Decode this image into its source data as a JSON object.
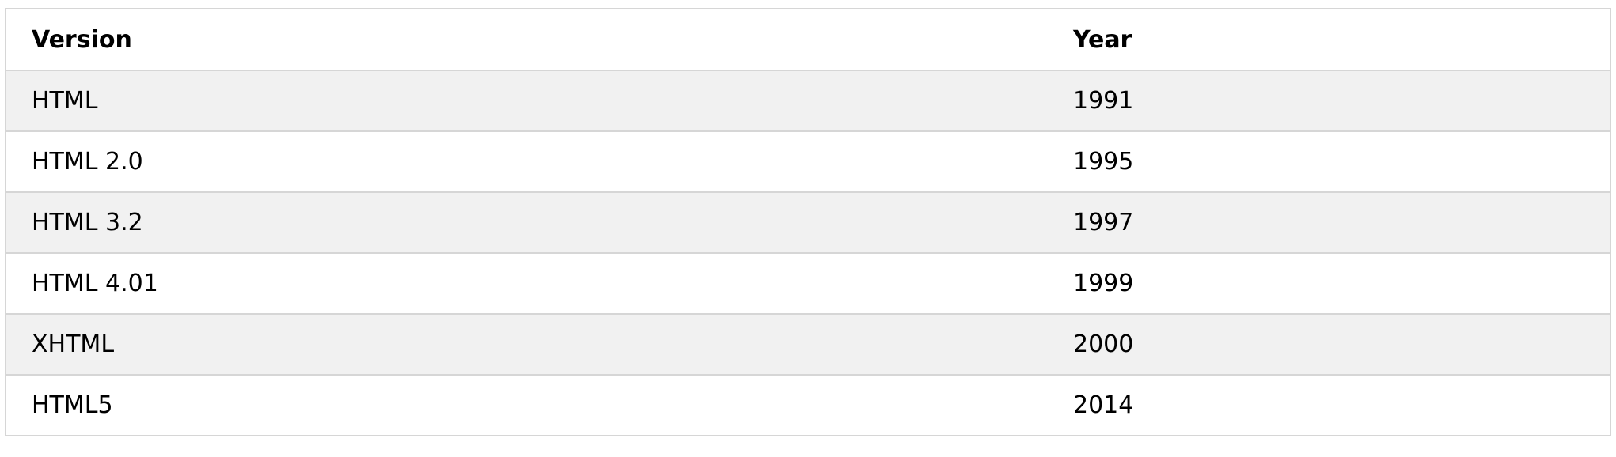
{
  "table": {
    "headers": {
      "version": "Version",
      "year": "Year"
    },
    "rows": [
      {
        "version": "HTML",
        "year": "1991"
      },
      {
        "version": "HTML 2.0",
        "year": "1995"
      },
      {
        "version": "HTML 3.2",
        "year": "1997"
      },
      {
        "version": "HTML 4.01",
        "year": "1999"
      },
      {
        "version": "XHTML",
        "year": "2000"
      },
      {
        "version": "HTML5",
        "year": "2014"
      }
    ],
    "colors": {
      "border": "#d6d6d6",
      "stripe": "#f1f1f1",
      "background": "#ffffff"
    }
  }
}
